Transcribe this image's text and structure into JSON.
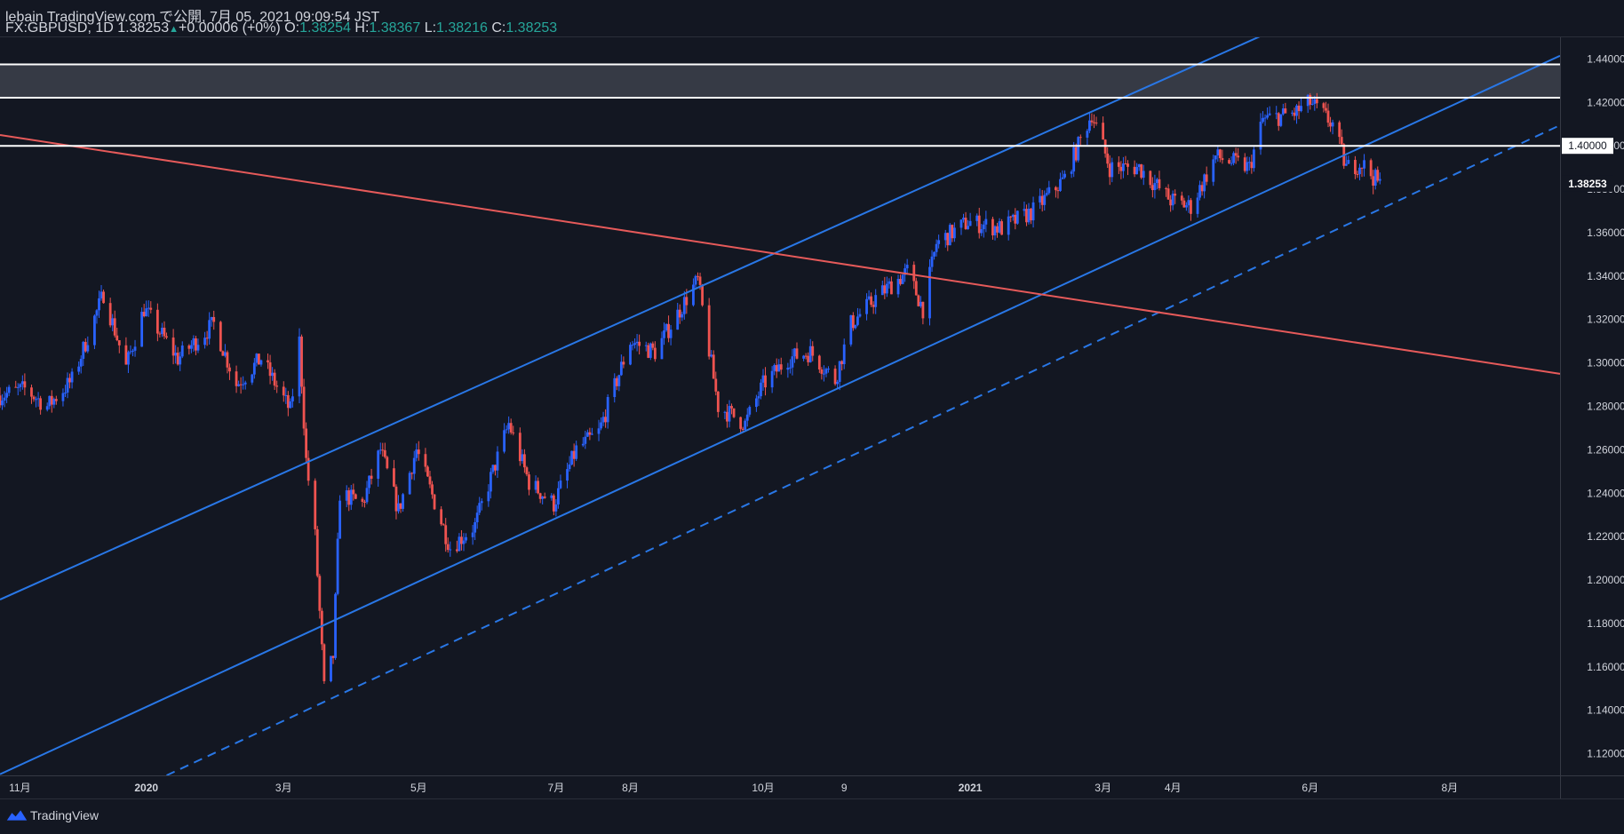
{
  "header": {
    "publish_line": "lebain TradingView.com で公開, 7月 05, 2021 09:09:54 JST",
    "symbol": "FX:GBPUSD, 1D",
    "last": "1.38253",
    "change_arrow": "▲",
    "change": "+0.00006 (+0%)",
    "o_label": "O:",
    "o_value": "1.38254",
    "h_label": "H:",
    "h_value": "1.38367",
    "l_label": "L:",
    "l_value": "1.38216",
    "c_label": "C:",
    "c_value": "1.38253"
  },
  "footer": {
    "brand": "TradingView",
    "logo_icon": "tradingview-logo-icon"
  },
  "colors": {
    "background": "#131722",
    "up": "#2962ff",
    "down": "#ef5350",
    "channel": "#2977e6",
    "trend": "#e65a5a",
    "level": "#ffffff",
    "zone": "#363a45",
    "text": "#d1d4dc"
  },
  "chart_data": {
    "type": "candlestick",
    "symbol": "FX:GBPUSD",
    "interval": "1D",
    "y_axis": {
      "range": [
        1.11,
        1.45
      ],
      "ticks": [
        "1.12000",
        "1.14000",
        "1.16000",
        "1.18000",
        "1.20000",
        "1.22000",
        "1.24000",
        "1.26000",
        "1.28000",
        "1.30000",
        "1.32000",
        "1.34000",
        "1.36000",
        "1.38000",
        "1.40000",
        "1.42000",
        "1.44000"
      ],
      "last_price_label": "1.38253",
      "level_label": "1.40000"
    },
    "x_axis": {
      "range": [
        "2019-10-28",
        "2021-09-20"
      ],
      "ticks": [
        {
          "date": "2019-11-01",
          "label": "11月"
        },
        {
          "date": "2020-01-01",
          "label": "2020"
        },
        {
          "date": "2020-03-02",
          "label": "3月"
        },
        {
          "date": "2020-05-01",
          "label": "5月"
        },
        {
          "date": "2020-07-01",
          "label": "7月"
        },
        {
          "date": "2020-08-03",
          "label": "8月"
        },
        {
          "date": "2020-10-01",
          "label": "10月"
        },
        {
          "date": "2020-11-06",
          "label": "9"
        },
        {
          "date": "2021-01-01",
          "label": "2021"
        },
        {
          "date": "2021-03-01",
          "label": "3月"
        },
        {
          "date": "2021-04-01",
          "label": "4月"
        },
        {
          "date": "2021-06-01",
          "label": "6月"
        },
        {
          "date": "2021-08-02",
          "label": "8月"
        }
      ]
    },
    "price_path": [
      {
        "date": "2019-10-28",
        "close": 1.285
      },
      {
        "date": "2019-11-08",
        "close": 1.288
      },
      {
        "date": "2019-11-18",
        "close": 1.28
      },
      {
        "date": "2019-11-29",
        "close": 1.292
      },
      {
        "date": "2019-12-13",
        "close": 1.332
      },
      {
        "date": "2019-12-23",
        "close": 1.298
      },
      {
        "date": "2019-12-31",
        "close": 1.325
      },
      {
        "date": "2020-01-15",
        "close": 1.302
      },
      {
        "date": "2020-01-31",
        "close": 1.318
      },
      {
        "date": "2020-02-10",
        "close": 1.29
      },
      {
        "date": "2020-02-21",
        "close": 1.302
      },
      {
        "date": "2020-03-05",
        "close": 1.278
      },
      {
        "date": "2020-03-09",
        "close": 1.31
      },
      {
        "date": "2020-03-12",
        "close": 1.255
      },
      {
        "date": "2020-03-16",
        "close": 1.22
      },
      {
        "date": "2020-03-20",
        "close": 1.15
      },
      {
        "date": "2020-03-24",
        "close": 1.165
      },
      {
        "date": "2020-03-27",
        "close": 1.24
      },
      {
        "date": "2020-04-06",
        "close": 1.235
      },
      {
        "date": "2020-04-14",
        "close": 1.26
      },
      {
        "date": "2020-04-22",
        "close": 1.232
      },
      {
        "date": "2020-04-30",
        "close": 1.26
      },
      {
        "date": "2020-05-15",
        "close": 1.215
      },
      {
        "date": "2020-05-26",
        "close": 1.225
      },
      {
        "date": "2020-06-10",
        "close": 1.272
      },
      {
        "date": "2020-06-19",
        "close": 1.245
      },
      {
        "date": "2020-06-30",
        "close": 1.235
      },
      {
        "date": "2020-07-10",
        "close": 1.26
      },
      {
        "date": "2020-07-20",
        "close": 1.268
      },
      {
        "date": "2020-08-03",
        "close": 1.31
      },
      {
        "date": "2020-08-14",
        "close": 1.305
      },
      {
        "date": "2020-08-31",
        "close": 1.335
      },
      {
        "date": "2020-09-02",
        "close": 1.338
      },
      {
        "date": "2020-09-11",
        "close": 1.28
      },
      {
        "date": "2020-09-23",
        "close": 1.272
      },
      {
        "date": "2020-10-01",
        "close": 1.29
      },
      {
        "date": "2020-10-12",
        "close": 1.302
      },
      {
        "date": "2020-10-22",
        "close": 1.305
      },
      {
        "date": "2020-11-02",
        "close": 1.292
      },
      {
        "date": "2020-11-09",
        "close": 1.318
      },
      {
        "date": "2020-11-20",
        "close": 1.33
      },
      {
        "date": "2020-12-04",
        "close": 1.342
      },
      {
        "date": "2020-12-11",
        "close": 1.325
      },
      {
        "date": "2020-12-17",
        "close": 1.355
      },
      {
        "date": "2020-12-31",
        "close": 1.365
      },
      {
        "date": "2021-01-15",
        "close": 1.362
      },
      {
        "date": "2021-01-29",
        "close": 1.37
      },
      {
        "date": "2021-02-12",
        "close": 1.385
      },
      {
        "date": "2021-02-24",
        "close": 1.415
      },
      {
        "date": "2021-03-04",
        "close": 1.39
      },
      {
        "date": "2021-03-17",
        "close": 1.39
      },
      {
        "date": "2021-03-31",
        "close": 1.375
      },
      {
        "date": "2021-04-09",
        "close": 1.372
      },
      {
        "date": "2021-04-20",
        "close": 1.395
      },
      {
        "date": "2021-05-05",
        "close": 1.39
      },
      {
        "date": "2021-05-11",
        "close": 1.412
      },
      {
        "date": "2021-05-25",
        "close": 1.415
      },
      {
        "date": "2021-06-01",
        "close": 1.42
      },
      {
        "date": "2021-06-11",
        "close": 1.41
      },
      {
        "date": "2021-06-17",
        "close": 1.39
      },
      {
        "date": "2021-06-24",
        "close": 1.392
      },
      {
        "date": "2021-07-02",
        "close": 1.382
      }
    ],
    "drawings": [
      {
        "kind": "line",
        "role": "channel-upper",
        "style": "solid",
        "points": [
          {
            "date": "2019-10-28",
            "price": 1.191
          },
          {
            "date": "2021-05-25",
            "price": 1.4575
          }
        ]
      },
      {
        "kind": "line",
        "role": "channel-lower",
        "style": "solid",
        "points": [
          {
            "date": "2019-10-28",
            "price": 1.1105
          },
          {
            "date": "2021-09-20",
            "price": 1.4415
          }
        ]
      },
      {
        "kind": "line",
        "role": "channel-median",
        "style": "dashed",
        "points": [
          {
            "date": "2020-01-10",
            "price": 1.11
          },
          {
            "date": "2021-09-20",
            "price": 1.4095
          }
        ]
      },
      {
        "kind": "line",
        "role": "downtrend",
        "style": "solid",
        "points": [
          {
            "date": "2019-10-28",
            "price": 1.405
          },
          {
            "date": "2021-09-20",
            "price": 1.295
          }
        ]
      },
      {
        "kind": "hline",
        "price": 1.4
      },
      {
        "kind": "hline",
        "price": 1.4222
      },
      {
        "kind": "hline",
        "price": 1.4375
      },
      {
        "kind": "zone",
        "from": 1.4222,
        "to": 1.4375
      }
    ]
  }
}
